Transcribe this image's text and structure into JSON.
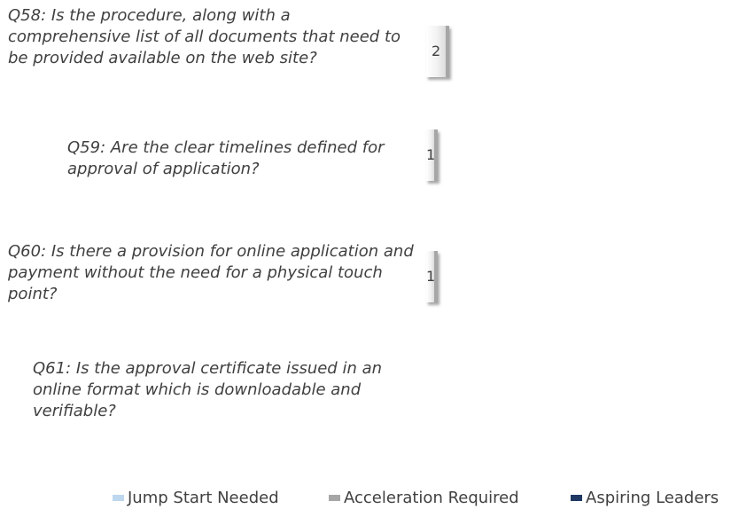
{
  "chart_data": {
    "type": "bar",
    "orientation": "horizontal",
    "categories": [
      "Q58: Is the procedure, along with a comprehensive list of all documents that need to be provided available on the web site?",
      "Q59: Are the clear timelines defined for approval of application?",
      "Q60: Is there a provision for online application and payment without the need for a physical touch point?",
      "Q61: Is the approval certificate issued in an online format which is downloadable and verifiable?"
    ],
    "series": [
      {
        "name": "Jump Start Needed",
        "color": "#bdd7ee",
        "values": [
          0,
          0,
          0,
          0
        ]
      },
      {
        "name": "Acceleration Required",
        "color": "#a6a6a6",
        "values": [
          2,
          1,
          1,
          0
        ]
      },
      {
        "name": "Aspiring Leaders",
        "color": "#1f3864",
        "values": [
          0,
          0,
          0,
          0
        ]
      }
    ],
    "data_labels": [
      "2",
      "1",
      "1",
      ""
    ],
    "legend_position": "bottom",
    "grid": false,
    "title": "",
    "xlabel": "",
    "ylabel": ""
  }
}
